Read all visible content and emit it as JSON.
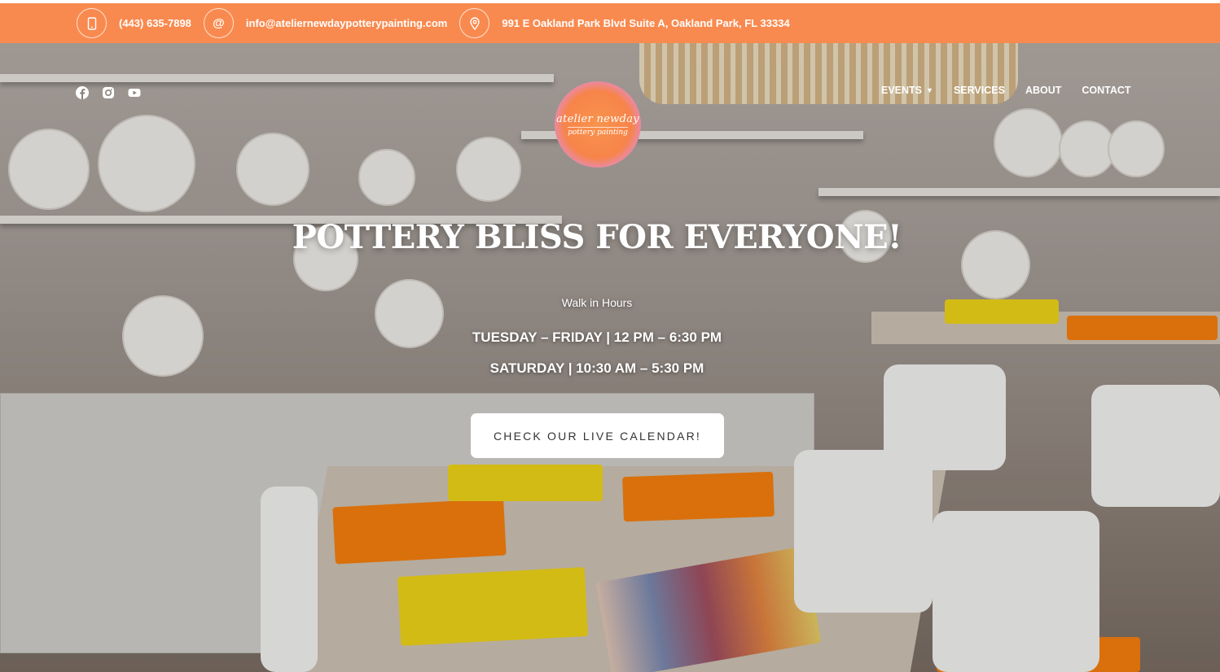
{
  "topbar": {
    "phone": "(443) 635-7898",
    "email": "info@ateliernewdaypotterypainting.com",
    "address": "991 E Oakland Park Blvd Suite A, Oakland Park, FL 33334",
    "phone_icon": "phone-icon",
    "email_icon": "at-icon",
    "address_icon": "map-pin-icon",
    "background": "#f98a4f"
  },
  "social": [
    "facebook-icon",
    "instagram-icon",
    "youtube-icon"
  ],
  "logo": {
    "line1": "atelier newday",
    "line2": "pottery painting"
  },
  "nav": {
    "events": "EVENTS",
    "services": "SERVICES",
    "about": "ABOUT",
    "contact": "CONTACT"
  },
  "hero": {
    "headline": "POTTERY BLISS FOR EVERYONE!",
    "walkin": "Walk in Hours",
    "hours_weekday": "TUESDAY – FRIDAY | 12 PM – 6:30 PM",
    "hours_saturday": "SATURDAY | 10:30 AM – 5:30 PM",
    "cta": "CHECK OUR LIVE CALENDAR!"
  }
}
